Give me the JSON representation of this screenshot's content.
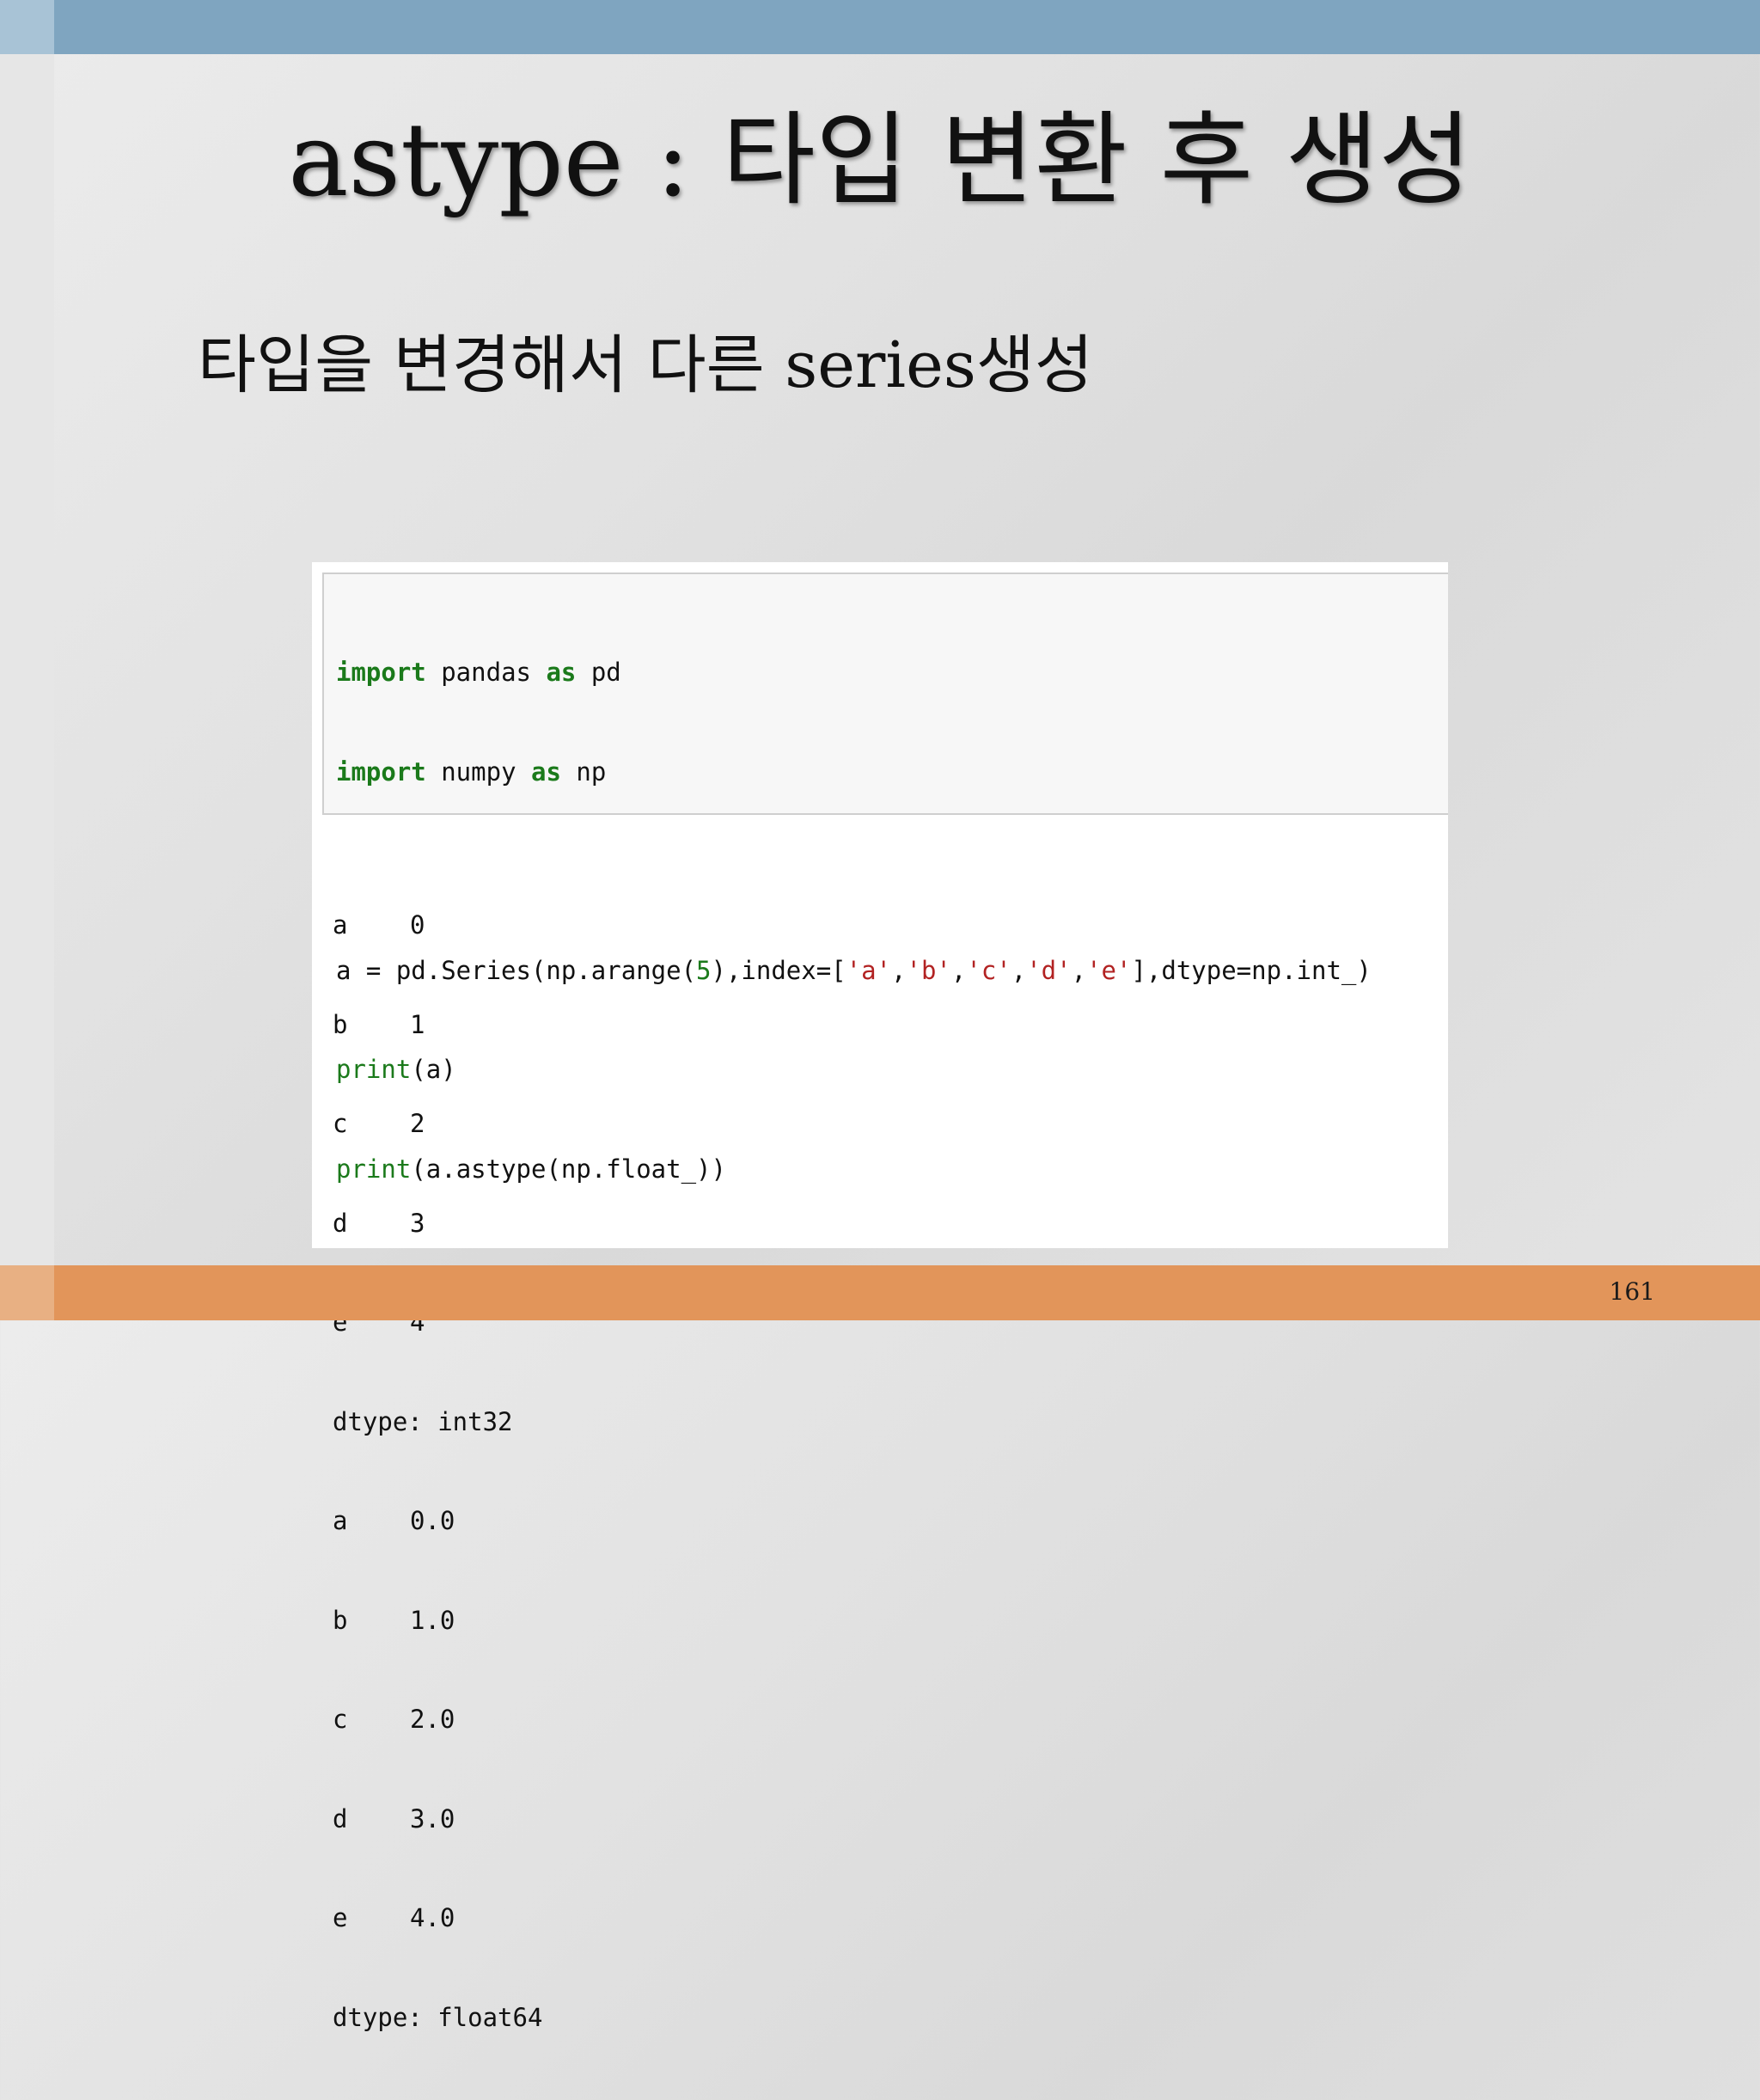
{
  "slide": {
    "title": "astype : 타입 변환 후 생성",
    "subtitle": "타입을 변경해서 다른 series생성",
    "page_number": "161"
  },
  "code": {
    "line1": {
      "kw1": "import",
      "mid": " pandas ",
      "kw2": "as",
      "end": " pd"
    },
    "line2": {
      "kw1": "import",
      "mid": " numpy ",
      "kw2": "as",
      "end": " np"
    },
    "line3": {
      "p1": "a = pd.Series(np.arange(",
      "n1": "5",
      "p2": "),index=[",
      "s1": "'a'",
      "c1": ",",
      "s2": "'b'",
      "c2": ",",
      "s3": "'c'",
      "c3": ",",
      "s4": "'d'",
      "c4": ",",
      "s5": "'e'",
      "p3": "],dtype=np.int_)"
    },
    "line4": {
      "fn": "print",
      "rest": "(a)"
    },
    "line5": {
      "fn": "print",
      "rest": "(a.astype(np.float_))"
    }
  },
  "output": {
    "int_rows": [
      {
        "index": "a",
        "value": "0"
      },
      {
        "index": "b",
        "value": "1"
      },
      {
        "index": "c",
        "value": "2"
      },
      {
        "index": "d",
        "value": "3"
      },
      {
        "index": "e",
        "value": "4"
      }
    ],
    "int_dtype": "dtype: int32",
    "float_rows": [
      {
        "index": "a",
        "value": "0.0"
      },
      {
        "index": "b",
        "value": "1.0"
      },
      {
        "index": "c",
        "value": "2.0"
      },
      {
        "index": "d",
        "value": "3.0"
      },
      {
        "index": "e",
        "value": "4.0"
      }
    ],
    "float_dtype": "dtype: float64"
  }
}
